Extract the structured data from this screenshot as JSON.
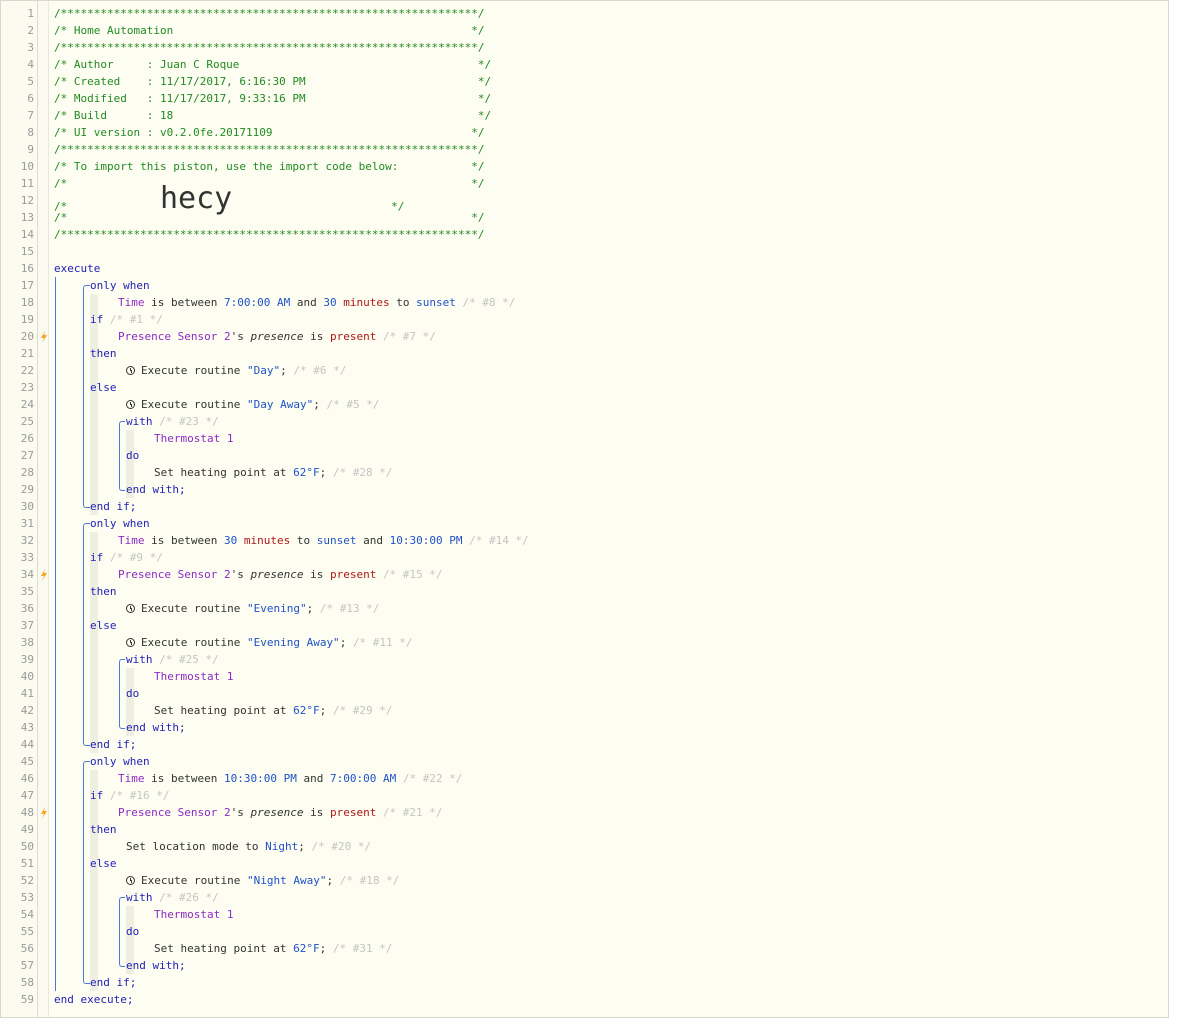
{
  "header": {
    "border": "/***************************************************************/",
    "title": "/* Home Automation                                             */",
    "author": "/* Author     : Juan C Roque                                    */",
    "created": "/* Created    : 11/17/2017, 6:16:30 PM                          */",
    "modified": "/* Modified   : 11/17/2017, 9:33:16 PM                          */",
    "build": "/* Build      : 18                                              */",
    "ui_version": "/* UI version : v0.2.0fe.20171109                              */",
    "import_note": "/* To import this piston, use the import code below:           */",
    "blank": "/*                                                             */",
    "import_prefix": "/*              ",
    "import_code": "hecy",
    "import_suffix": "                        */"
  },
  "kw": {
    "execute": "execute",
    "end_execute": "end execute;",
    "only_when": "only when",
    "if": "if",
    "then": "then",
    "else": "else",
    "end_if": "end if;",
    "with": "with",
    "do": "do",
    "end_with": "end with;"
  },
  "blocks": [
    {
      "time_condition": {
        "a": "7:00:00 AM",
        "offset": "30",
        "unit": "minutes",
        "b": "sunset",
        "id": "/* #8 */",
        "form": "a_and_offset"
      },
      "if_id": "/* #1 */",
      "sensor": "Presence Sensor 2",
      "attr": "presence",
      "state": "present",
      "cond_id": "/* #7 */",
      "then_action": {
        "type": "routine",
        "name": "\"Day\"",
        "id": "/* #6 */"
      },
      "else_action": {
        "name": "\"Day Away\"",
        "id": "/* #5 */"
      },
      "with_id": "/* #23 */",
      "device": "Thermostat 1",
      "setpoint": "62°F",
      "set_id": "/* #28 */"
    },
    {
      "time_condition": {
        "a": "30",
        "unit": "minutes",
        "b": "sunset",
        "c": "10:30:00 PM",
        "id": "/* #14 */"
      },
      "if_id": "/* #9 */",
      "sensor": "Presence Sensor 2",
      "attr": "presence",
      "state": "present",
      "cond_id": "/* #15 */",
      "then_action": {
        "type": "routine",
        "name": "\"Evening\"",
        "id": "/* #13 */"
      },
      "else_action": {
        "name": "\"Evening Away\"",
        "id": "/* #11 */"
      },
      "with_id": "/* #25 */",
      "device": "Thermostat 1",
      "setpoint": "62°F",
      "set_id": "/* #29 */"
    },
    {
      "time_condition": {
        "a": "10:30:00 PM",
        "b": "7:00:00 AM",
        "id": "/* #22 */"
      },
      "if_id": "/* #16 */",
      "sensor": "Presence Sensor 2",
      "attr": "presence",
      "state": "present",
      "cond_id": "/* #21 */",
      "then_action": {
        "type": "mode",
        "mode": "Night",
        "id": "/* #20 */"
      },
      "else_action": {
        "name": "\"Night Away\"",
        "id": "/* #18 */"
      },
      "with_id": "/* #26 */",
      "device": "Thermostat 1",
      "setpoint": "62°F",
      "set_id": "/* #31 */"
    }
  ],
  "text": {
    "time": "Time",
    "is_between": " is between ",
    "and": " and ",
    "to": " to ",
    "s_possessive": "'s ",
    "is": " is ",
    "execute_routine": "Execute routine ",
    "set_location_mode": "Set location mode to ",
    "set_heating": "Set heating point at ",
    "semicolon": "; "
  },
  "colors": {
    "comment": "#228b22",
    "keyword": "#1f1fb8",
    "device": "#8b2bc7",
    "value": "#b01717",
    "id": "#c4c4c4",
    "bolt": "#f5a623"
  },
  "icons": {
    "trigger": "lightning-bolt-icon",
    "routine": "clock-icon"
  },
  "line_count": 59
}
